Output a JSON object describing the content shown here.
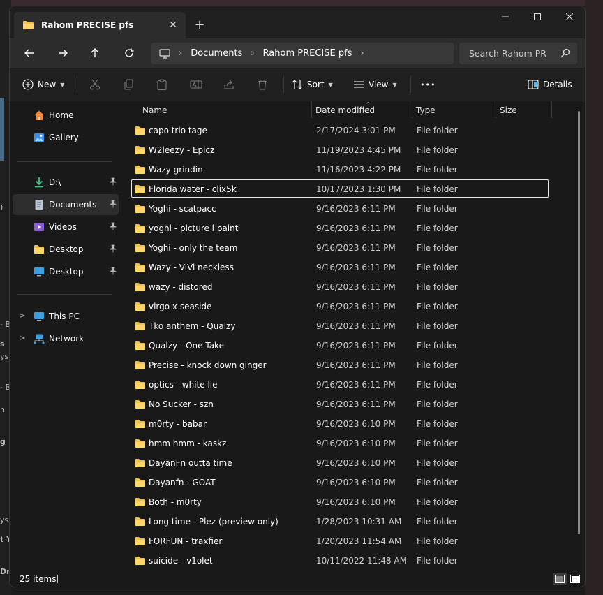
{
  "tab": {
    "title": "Rahom PRECISE pfs",
    "close": "✕",
    "new": "+"
  },
  "window_controls": {
    "minimize": "—",
    "maximize": "☐",
    "close": "✕"
  },
  "address": {
    "separator": "›",
    "crumbs": [
      "Documents",
      "Rahom PRECISE pfs"
    ]
  },
  "search": {
    "placeholder": "Search Rahom PRECISE pfs"
  },
  "commands": {
    "new_label": "New",
    "sort_label": "Sort",
    "view_label": "View",
    "more_label": "•••",
    "details_label": "Details"
  },
  "sidebar": {
    "items": [
      {
        "label": "Home"
      },
      {
        "label": "Gallery"
      },
      {
        "label": "D:\\"
      },
      {
        "label": "Documents"
      },
      {
        "label": "Videos"
      },
      {
        "label": "Desktop"
      },
      {
        "label": "Desktop"
      },
      {
        "label": "This PC"
      },
      {
        "label": "Network"
      }
    ]
  },
  "columns": {
    "name": "Name",
    "date": "Date modified",
    "type": "Type",
    "size": "Size"
  },
  "files": [
    {
      "name": "capo trio tage",
      "date": "2/17/2024 3:01 PM",
      "type": "File folder"
    },
    {
      "name": "W2leezy - Epicz",
      "date": "11/19/2023 4:45 PM",
      "type": "File folder"
    },
    {
      "name": "Wazy grindin",
      "date": "11/16/2023 4:22 PM",
      "type": "File folder"
    },
    {
      "name": "Florida water - clix5k",
      "date": "10/17/2023 1:30 PM",
      "type": "File folder"
    },
    {
      "name": "Yoghi - scatpacc",
      "date": "9/16/2023 6:11 PM",
      "type": "File folder"
    },
    {
      "name": "yoghi - picture i paint",
      "date": "9/16/2023 6:11 PM",
      "type": "File folder"
    },
    {
      "name": "Yoghi - only the team",
      "date": "9/16/2023 6:11 PM",
      "type": "File folder"
    },
    {
      "name": "Wazy - ViVi neckless",
      "date": "9/16/2023 6:11 PM",
      "type": "File folder"
    },
    {
      "name": "wazy - distored",
      "date": "9/16/2023 6:11 PM",
      "type": "File folder"
    },
    {
      "name": "virgo x seaside",
      "date": "9/16/2023 6:11 PM",
      "type": "File folder"
    },
    {
      "name": "Tko anthem - Qualzy",
      "date": "9/16/2023 6:11 PM",
      "type": "File folder"
    },
    {
      "name": "Qualzy - One Take",
      "date": "9/16/2023 6:11 PM",
      "type": "File folder"
    },
    {
      "name": "Precise - knock down ginger",
      "date": "9/16/2023 6:11 PM",
      "type": "File folder"
    },
    {
      "name": "optics - white lie",
      "date": "9/16/2023 6:11 PM",
      "type": "File folder"
    },
    {
      "name": "No Sucker - szn",
      "date": "9/16/2023 6:11 PM",
      "type": "File folder"
    },
    {
      "name": "m0rty - babar",
      "date": "9/16/2023 6:10 PM",
      "type": "File folder"
    },
    {
      "name": "hmm hmm - kaskz",
      "date": "9/16/2023 6:10 PM",
      "type": "File folder"
    },
    {
      "name": "DayanFn outta time",
      "date": "9/16/2023 6:10 PM",
      "type": "File folder"
    },
    {
      "name": "Dayanfn - GOAT",
      "date": "9/16/2023 6:10 PM",
      "type": "File folder"
    },
    {
      "name": "Both - m0rty",
      "date": "9/16/2023 6:10 PM",
      "type": "File folder"
    },
    {
      "name": "Long time - Plez (preview only)",
      "date": "1/28/2023 10:31 AM",
      "type": "File folder"
    },
    {
      "name": "FORFUN - traxfier",
      "date": "1/20/2023 11:54 AM",
      "type": "File folder"
    },
    {
      "name": "suicide - v1olet",
      "date": "10/11/2022 11:48 AM",
      "type": "File folder"
    }
  ],
  "status": {
    "count": "25 items"
  },
  "background_fragments": [
    "- B",
    "s",
    "ys",
    "- B",
    "n",
    "g",
    "ys",
    "t Y",
    "Dr"
  ],
  "colors": {
    "folder": "#f0c050",
    "accent": "#4cc2ff"
  }
}
